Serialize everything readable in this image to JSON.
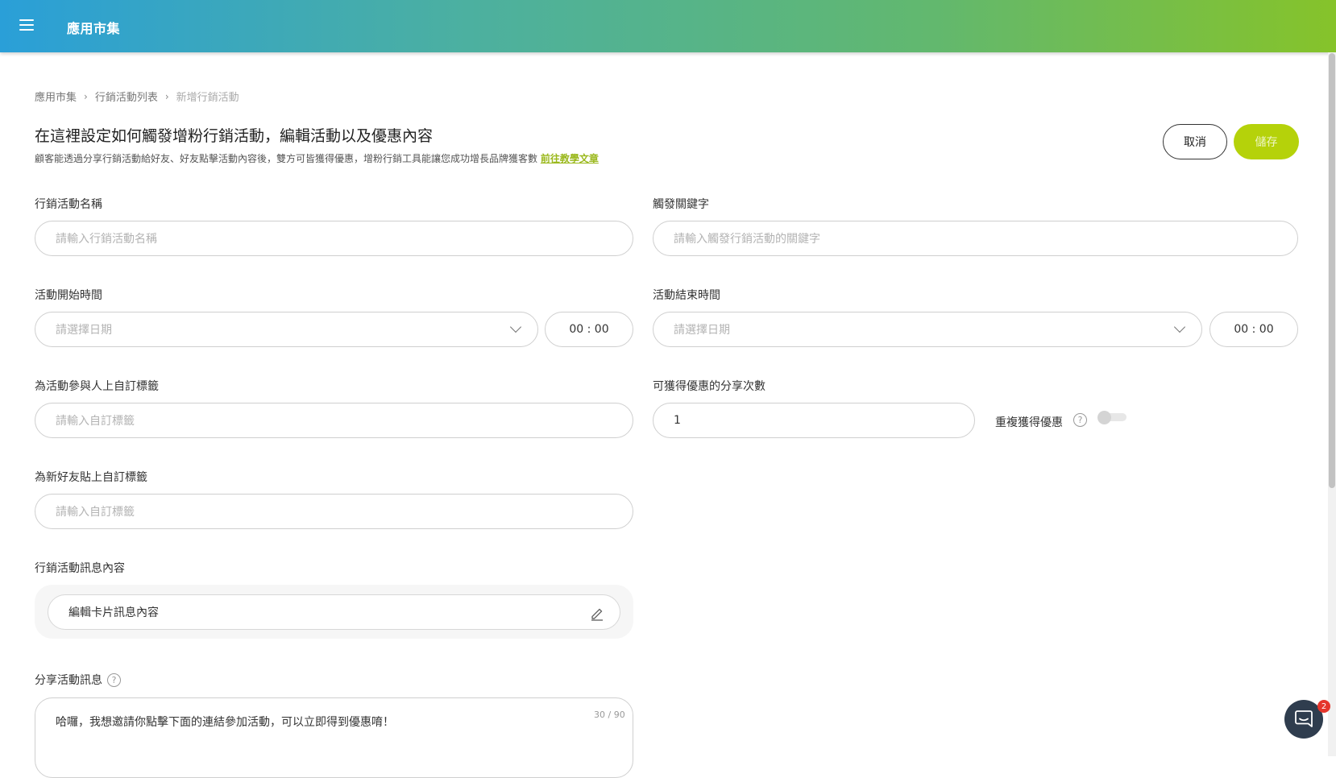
{
  "header": {
    "app_title": "應用市集"
  },
  "breadcrumb": [
    "應用市集",
    "行銷活動列表",
    "新增行銷活動"
  ],
  "page": {
    "title": "在這裡設定如何觸發增粉行銷活動，編輯活動以及優惠內容",
    "description": "顧客能透過分享行銷活動給好友、好友點擊活動內容後，雙方可皆獲得優惠，增粉行銷工具能讓您成功增長品牌獲客數",
    "tutorial_link": "前往教學文章"
  },
  "actions": {
    "cancel": "取消",
    "save": "儲存"
  },
  "form": {
    "campaign_name": {
      "label": "行銷活動名稱",
      "placeholder": "請輸入行銷活動名稱"
    },
    "keyword": {
      "label": "觸發關鍵字",
      "placeholder": "請輸入觸發行銷活動的關鍵字"
    },
    "start_time": {
      "label": "活動開始時間",
      "date_placeholder": "請選擇日期",
      "time": "00 : 00"
    },
    "end_time": {
      "label": "活動結束時間",
      "date_placeholder": "請選擇日期",
      "time": "00 : 00"
    },
    "participant_tag": {
      "label": "為活動參與人上自訂標籤",
      "placeholder": "請輸入自訂標籤"
    },
    "share_count": {
      "label": "可獲得優惠的分享次數",
      "value": "1"
    },
    "repeat_reward": {
      "label": "重複獲得優惠",
      "enabled": false
    },
    "new_friend_tag": {
      "label": "為新好友貼上自訂標籤",
      "placeholder": "請輸入自訂標籤"
    },
    "message_content": {
      "label": "行銷活動訊息內容",
      "edit_card": "編輯卡片訊息內容"
    },
    "share_message": {
      "label": "分享活動訊息",
      "value": "哈囉，我想邀請你點擊下面的連結參加活動，可以立即得到優惠唷！",
      "counter": "30 / 90"
    }
  },
  "chat": {
    "badge": "2"
  },
  "icons": {
    "menu": "hamburger-icon",
    "chevron": "chevron-right-icon",
    "dropdown": "chevron-down-icon",
    "help": "help-circle-icon",
    "edit": "pencil-icon",
    "chat": "chat-bubble-icon"
  },
  "colors": {
    "accent": "#b5d20a",
    "link": "#9ab81c",
    "badge": "#e5352b",
    "chat_button": "#2f3d4e"
  },
  "help_glyph": "?"
}
